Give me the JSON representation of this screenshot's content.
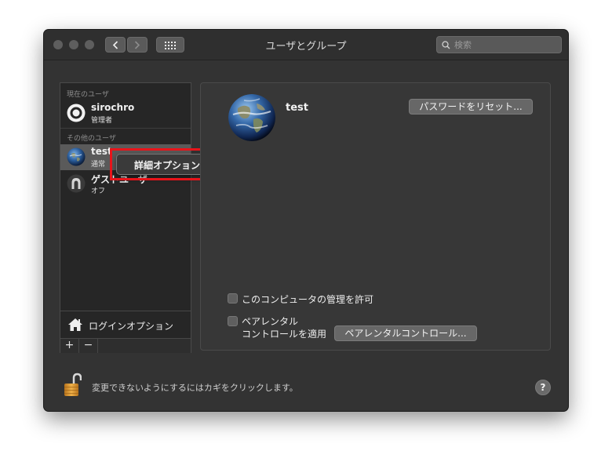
{
  "window": {
    "title": "ユーザとグループ",
    "search_placeholder": "検索"
  },
  "sidebar": {
    "current_user_label": "現在のユーザ",
    "other_users_label": "その他のユーザ",
    "users": [
      {
        "name": "sirochro",
        "role": "管理者",
        "icon": "admin-avatar-icon"
      },
      {
        "name": "test",
        "role": "通常",
        "icon": "earth-avatar-icon",
        "selected": true
      },
      {
        "name": "ゲストユーザ",
        "role": "オフ",
        "icon": "guest-avatar-icon"
      }
    ],
    "login_options_label": "ログインオプション",
    "add_label": "+",
    "remove_label": "−"
  },
  "context_menu": {
    "item": "詳細オプション..."
  },
  "detail": {
    "user_name": "test",
    "reset_password_label": "パスワードをリセット...",
    "allow_admin_label": "このコンピュータの管理を許可",
    "parental_label_line1": "ペアレンタル",
    "parental_label_line2": "コントロールを適用",
    "parental_button_label": "ペアレンタルコントロール..."
  },
  "footer": {
    "lock_text": "変更できないようにするにはカギをクリックします。",
    "help_label": "?"
  },
  "colors": {
    "window_bg": "#333333",
    "highlight": "#e8141a",
    "selection": "#5a5a5a"
  }
}
